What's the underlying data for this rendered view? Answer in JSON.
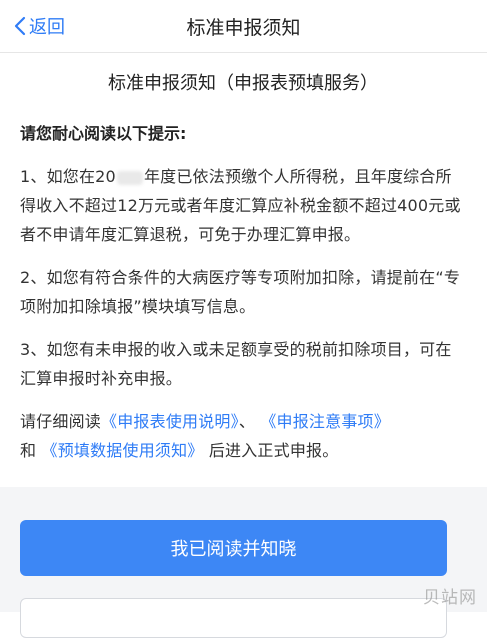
{
  "nav": {
    "back_label": "返回",
    "title": "标准申报须知"
  },
  "doc": {
    "title": "标准申报须知（申报表预填服务）",
    "intro": "请您耐心阅读以下提示:",
    "p1_a": "1、如您在20",
    "p1_b": "年度已依法预缴个人所得税，且年度综合所得收入不超过12万元或者年度汇算应补税金额不超过400元或者不申请年度汇算退税，可免于办理汇算申报。",
    "p2": "2、如您有符合条件的大病医疗等专项附加扣除，请提前在“专项附加扣除填报”模块填写信息。",
    "p3": "3、如您有未申报的收入或未足额享受的税前扣除项目，可在汇算申报时补充申报。",
    "p4_pre": "请仔细阅读",
    "p4_link1": "《申报表使用说明》",
    "p4_sep": "、",
    "p4_link2": "《申报注意事项》",
    "p4_and": "和",
    "p4_link3": "《预填数据使用须知》",
    "p4_post": "后进入正式申报。"
  },
  "actions": {
    "primary_label": "我已阅读并知晓"
  },
  "watermark": "贝站网",
  "colors": {
    "accent": "#2f7cf6",
    "button": "#3d87f5"
  },
  "icons": {
    "back": "chevron-left-icon"
  }
}
